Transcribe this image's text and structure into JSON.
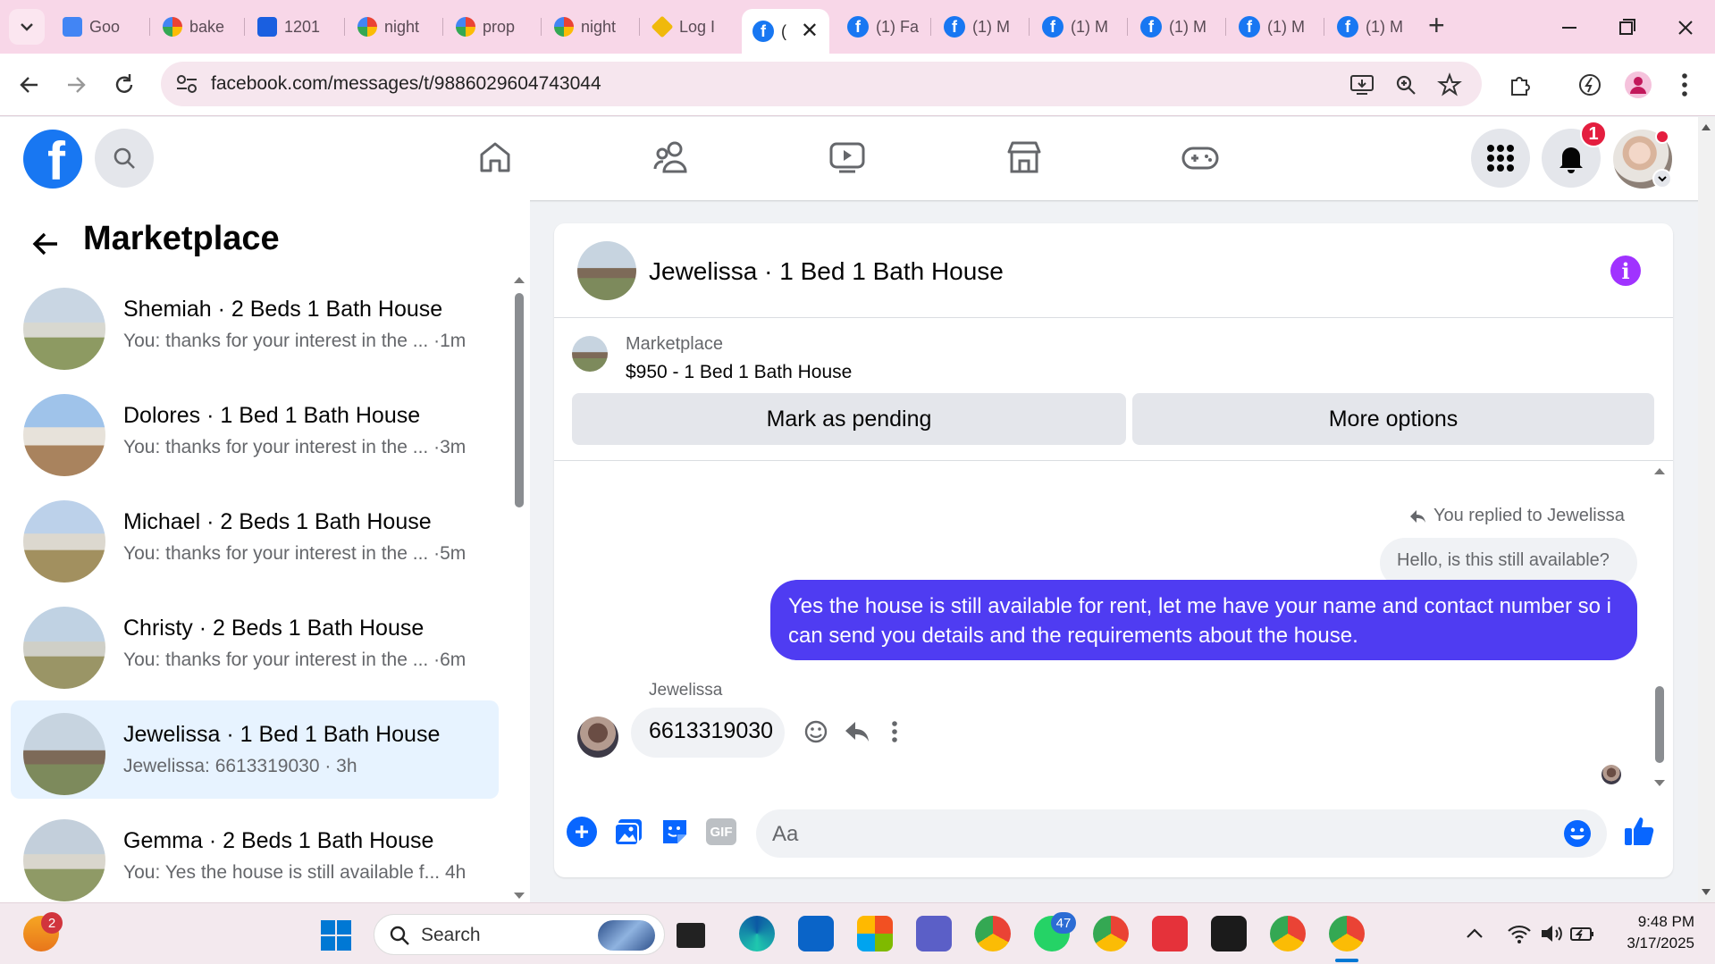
{
  "browser": {
    "tabs": [
      {
        "label": "Goo",
        "icon": "translate-icon"
      },
      {
        "label": "bake",
        "icon": "google-icon"
      },
      {
        "label": "1201",
        "icon": "zillow-icon"
      },
      {
        "label": "night",
        "icon": "google-icon"
      },
      {
        "label": "prop",
        "icon": "google-icon"
      },
      {
        "label": "night",
        "icon": "google-icon"
      },
      {
        "label": "Log I",
        "icon": "binance-icon"
      },
      {
        "label": "(",
        "icon": "facebook-icon"
      },
      {
        "label": "(1) Fa",
        "icon": "facebook-icon"
      },
      {
        "label": "(1) M",
        "icon": "facebook-icon"
      },
      {
        "label": "(1) M",
        "icon": "facebook-icon"
      },
      {
        "label": "(1) M",
        "icon": "facebook-icon"
      },
      {
        "label": "(1) M",
        "icon": "facebook-icon"
      },
      {
        "label": "(1) M",
        "icon": "facebook-icon"
      }
    ],
    "new_tab": "+",
    "url": "facebook.com/messages/t/9886029604743044"
  },
  "fb": {
    "logo": "f",
    "notification_count": "1"
  },
  "sidebar": {
    "title": "Marketplace",
    "conversations": [
      {
        "name": "Shemiah · 2 Beds 1 Bath House",
        "preview": "You: thanks for your interest in the ... ·1m",
        "active": false
      },
      {
        "name": "Dolores · 1 Bed 1 Bath House",
        "preview": "You: thanks for your interest in the ... ·3m",
        "active": false
      },
      {
        "name": "Michael · 2 Beds 1 Bath House",
        "preview": "You: thanks for your interest in the ... ·5m",
        "active": false
      },
      {
        "name": "Christy · 2 Beds 1 Bath House",
        "preview": "You: thanks for your interest in the ... ·6m",
        "active": false
      },
      {
        "name": "Jewelissa · 1 Bed 1 Bath House",
        "preview": "Jewelissa: 6613319030 · 3h",
        "active": true
      },
      {
        "name": "Gemma · 2 Beds 1 Bath House",
        "preview": "You: Yes the house is still available f...  4h",
        "active": false
      }
    ]
  },
  "chat": {
    "header_title": "Jewelissa · 1 Bed 1 Bath House",
    "listing_source": "Marketplace",
    "listing_title": "$950 - 1 Bed 1 Bath House",
    "mark_pending": "Mark as pending",
    "more_options": "More options",
    "replied_to": "You replied to Jewelissa",
    "quoted_message": "Hello, is this still available?",
    "my_message": "Yes the house is still available for rent, let me have your name and  contact number so i can send you details and the requirements about the house.",
    "sender_name": "Jewelissa",
    "their_message": "6613319030",
    "composer_placeholder": "Aa",
    "gif_label": "GIF"
  },
  "taskbar": {
    "search_label": "Search",
    "widgets_badge": "2",
    "whatsapp_badge": "47",
    "time": "9:48 PM",
    "date": "3/17/2025"
  },
  "colors": {
    "tab_strip": "#f8d7e8",
    "fb_blue": "#1877f2",
    "my_bubble": "#4f3cf2",
    "info_purple": "#a033ff"
  }
}
